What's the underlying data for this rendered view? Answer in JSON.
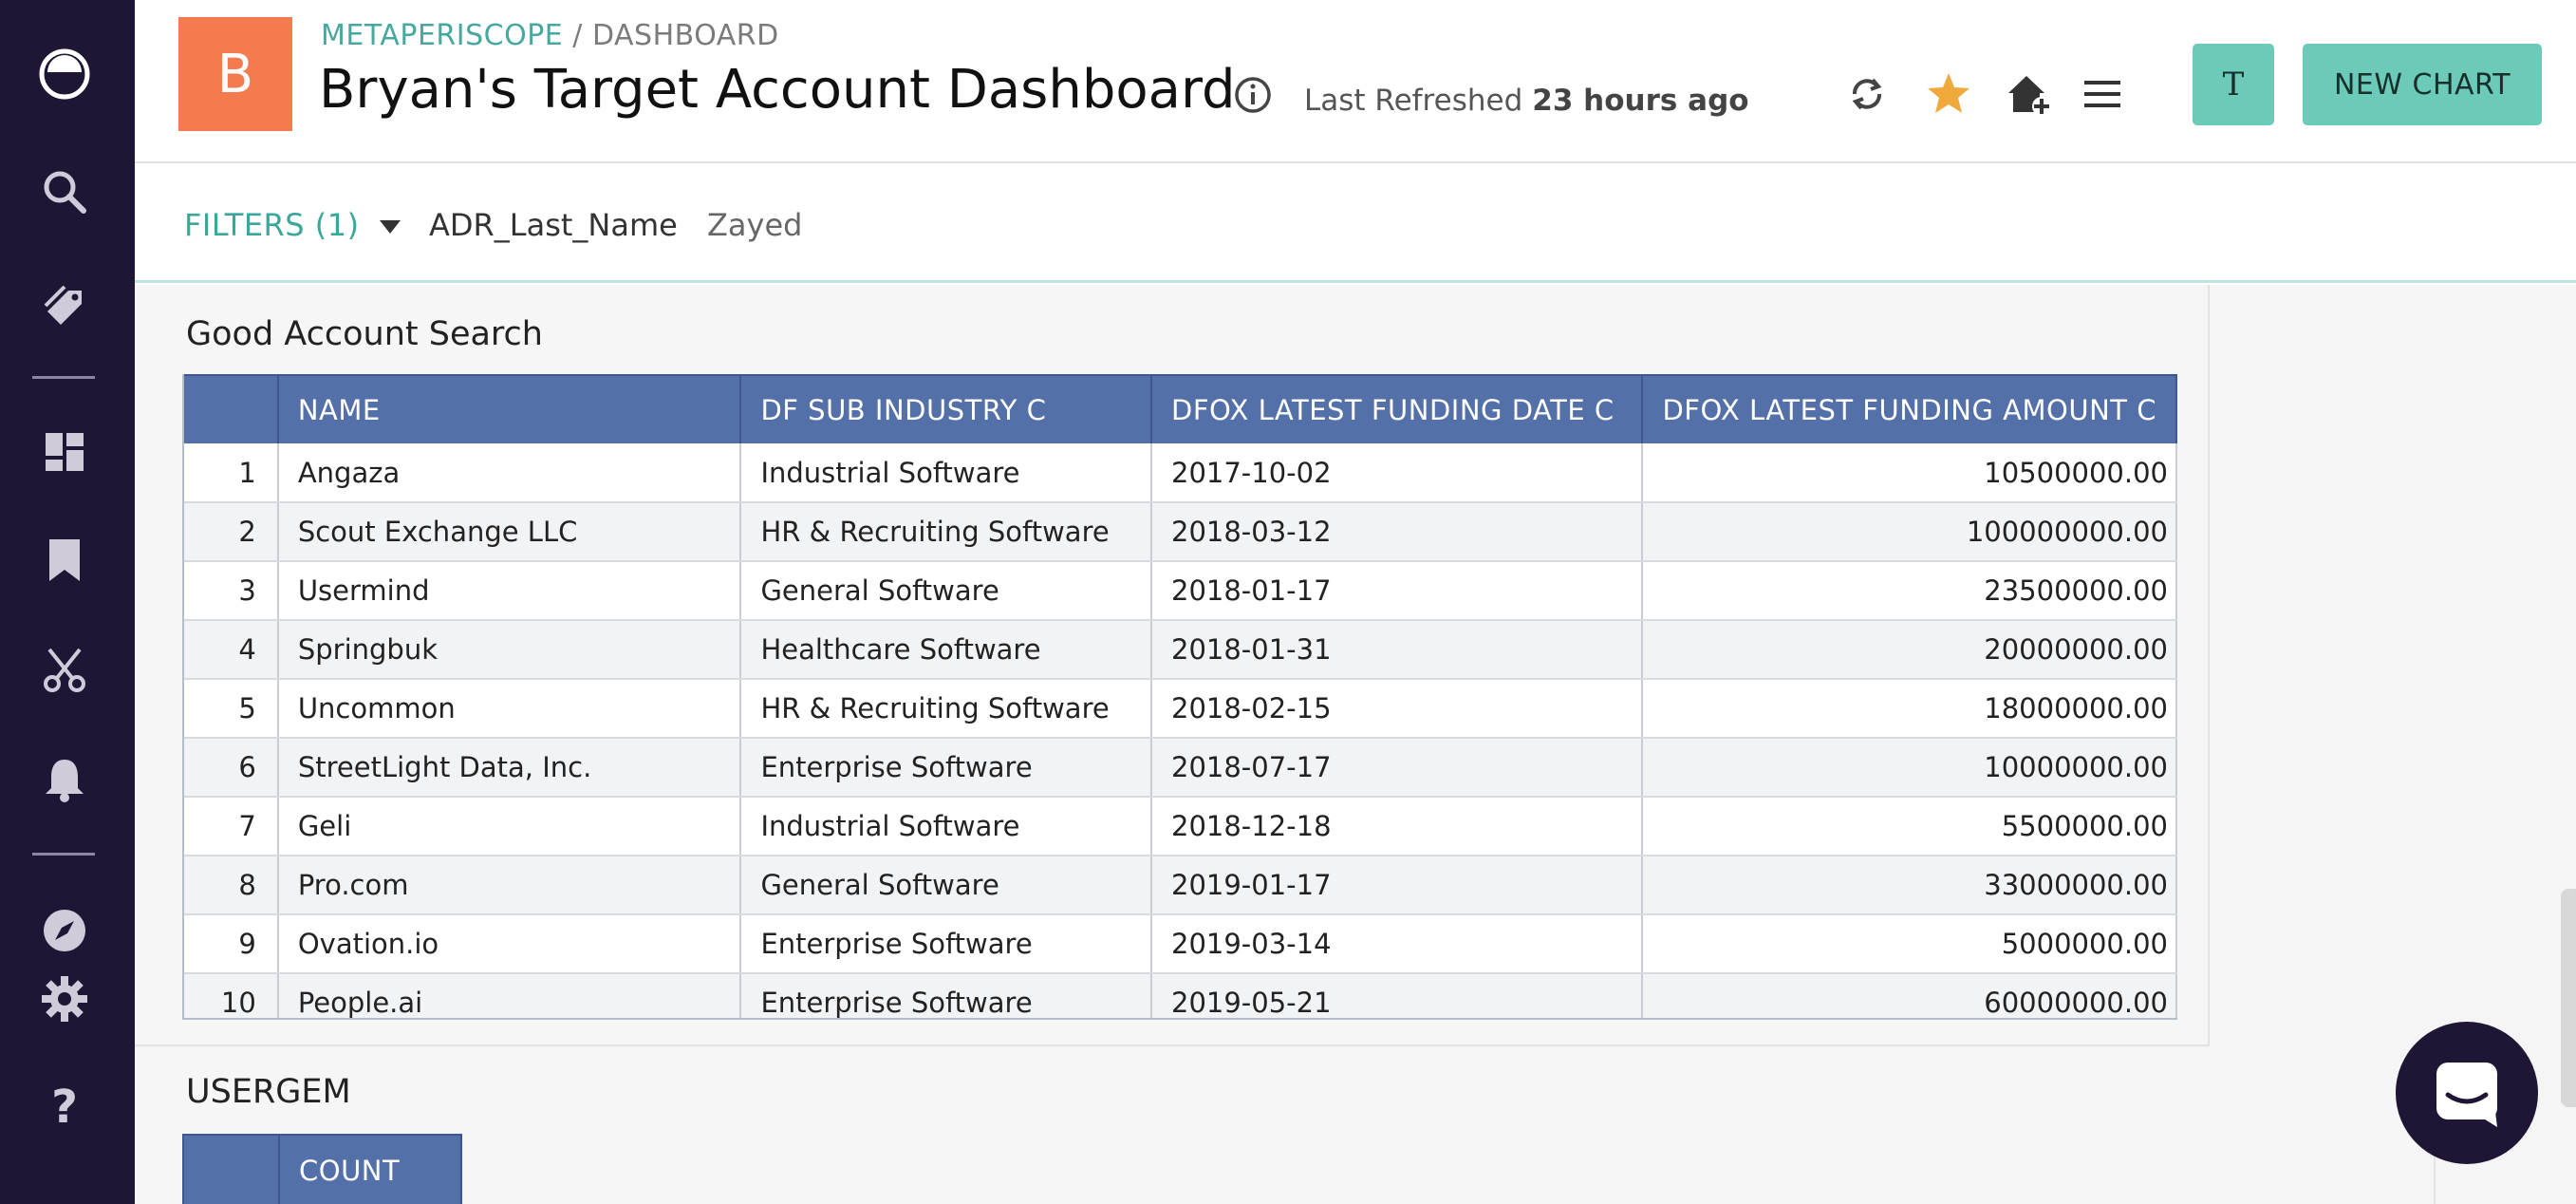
{
  "header": {
    "logo_letter": "B",
    "breadcrumb_org": "METAPERISCOPE",
    "breadcrumb_sep": " / ",
    "breadcrumb_page": "DASHBOARD",
    "title": "Bryan's Target Account Dashboard",
    "refreshed_label": "Last Refreshed",
    "refreshed_value": "23 hours ago",
    "user_initial": "T",
    "new_chart_label": "NEW CHART",
    "icons": [
      "refresh-icon",
      "star-icon",
      "home-add-icon",
      "menu-icon"
    ]
  },
  "sidebar": {
    "icons": [
      "logo-icon",
      "search-icon",
      "tag-icon",
      "dashboard-grid-icon",
      "bookmark-icon",
      "scissors-icon",
      "bell-icon",
      "compass-icon",
      "gear-icon",
      "help-icon"
    ]
  },
  "filters": {
    "label": "FILTERS",
    "count": "(1)",
    "name": "ADR_Last_Name",
    "value": "Zayed"
  },
  "widget1": {
    "title": "Good Account Search",
    "columns": [
      "",
      "NAME",
      "DF SUB INDUSTRY C",
      "DFOX LATEST FUNDING DATE C",
      "DFOX LATEST FUNDING AMOUNT C"
    ],
    "rows": [
      [
        "1",
        "Angaza",
        "Industrial Software",
        "2017-10-02",
        "10500000.00"
      ],
      [
        "2",
        "Scout Exchange LLC",
        "HR & Recruiting Software",
        "2018-03-12",
        "100000000.00"
      ],
      [
        "3",
        "Usermind",
        "General Software",
        "2018-01-17",
        "23500000.00"
      ],
      [
        "4",
        "Springbuk",
        "Healthcare Software",
        "2018-01-31",
        "20000000.00"
      ],
      [
        "5",
        "Uncommon",
        "HR & Recruiting Software",
        "2018-02-15",
        "18000000.00"
      ],
      [
        "6",
        "StreetLight Data, Inc.",
        "Enterprise Software",
        "2018-07-17",
        "10000000.00"
      ],
      [
        "7",
        "Geli",
        "Industrial Software",
        "2018-12-18",
        "5500000.00"
      ],
      [
        "8",
        "Pro.com",
        "General Software",
        "2019-01-17",
        "33000000.00"
      ],
      [
        "9",
        "Ovation.io",
        "Enterprise Software",
        "2019-03-14",
        "5000000.00"
      ],
      [
        "10",
        "People.ai",
        "Enterprise Software",
        "2019-05-21",
        "60000000.00"
      ]
    ]
  },
  "widget2": {
    "title": "USERGEM",
    "columns": [
      "",
      "COUNT"
    ]
  },
  "colors": {
    "sidebar_bg": "#1f1535",
    "accent": "#6ccab9",
    "logo_bg": "#f47b4f",
    "table_header": "#5470a8",
    "star": "#f0a93b"
  }
}
